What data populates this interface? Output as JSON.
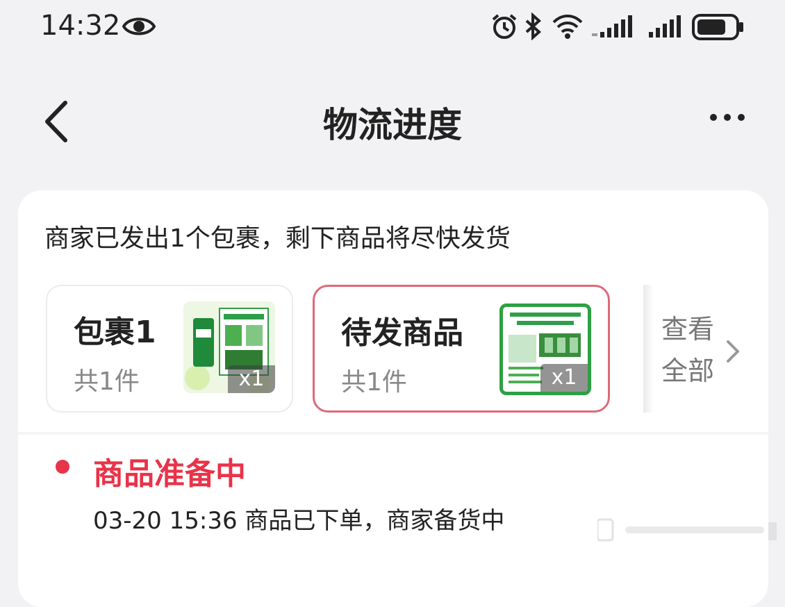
{
  "status_bar": {
    "time": "14:32",
    "icons": [
      "eye-icon",
      "alarm-icon",
      "bluetooth-icon",
      "wifi-icon",
      "signal-icon",
      "signal-icon",
      "battery-icon"
    ]
  },
  "header": {
    "title": "物流进度",
    "back_icon": "chevron-left-icon",
    "more_icon": "more-icon"
  },
  "notice": "商家已发出1个包裹，剩下商品将尽快发货",
  "packages": [
    {
      "title": "包裹1",
      "count": "共1件",
      "qty": "x1",
      "selected": false
    },
    {
      "title": "待发商品",
      "count": "共1件",
      "qty": "x1",
      "selected": true
    }
  ],
  "view_all": {
    "label": "查看全部"
  },
  "progress": {
    "status": "商品准备中",
    "detail": "03-20 15:36 商品已下单，商家备货中"
  },
  "colors": {
    "accent_red": "#e8334a",
    "selected_border": "#de6a78",
    "background": "#f2f2f5",
    "card": "#ffffff"
  }
}
